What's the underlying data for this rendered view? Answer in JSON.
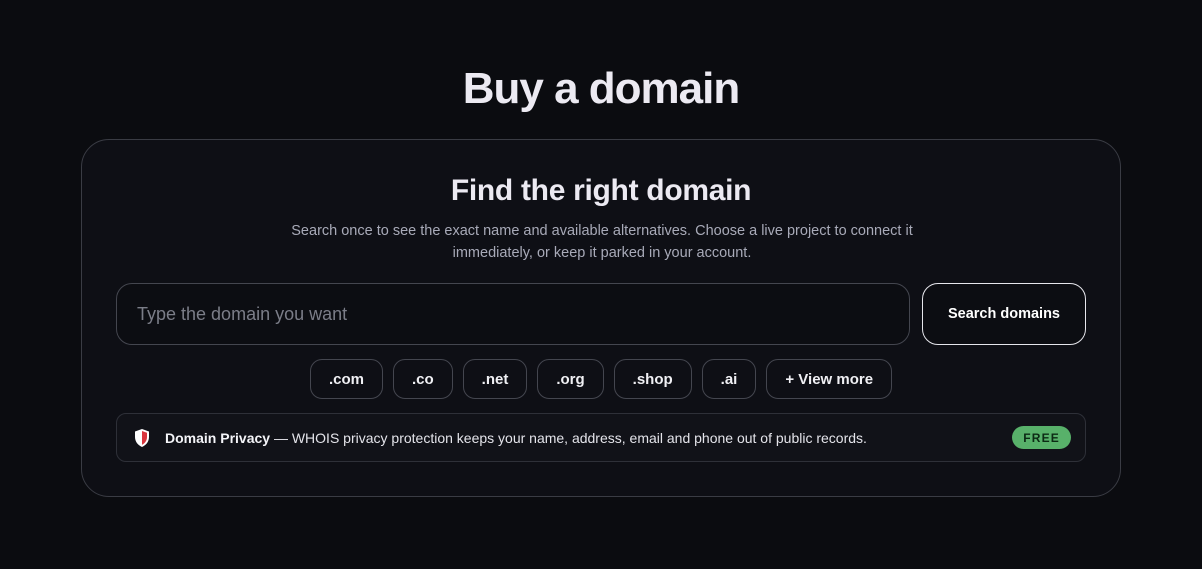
{
  "page": {
    "title": "Buy a domain"
  },
  "card": {
    "title": "Find the right domain",
    "description": "Search once to see the exact name and available alternatives. Choose a live project to connect it immediately, or keep it parked in your account."
  },
  "search": {
    "placeholder": "Type the domain you want",
    "value": "",
    "button_label": "Search domains"
  },
  "tlds": [
    ".com",
    ".co",
    ".net",
    ".org",
    ".shop",
    ".ai"
  ],
  "view_more_label": "+ View more",
  "privacy": {
    "icon": "shield-icon",
    "title": "Domain Privacy",
    "text": " — WHOIS privacy protection keeps your name, address, email and phone out of public records.",
    "badge": "FREE"
  },
  "colors": {
    "background": "#0b0c10",
    "card": "#0e0f15",
    "badge_green": "#58b16a",
    "shield_red": "#d9363e"
  }
}
